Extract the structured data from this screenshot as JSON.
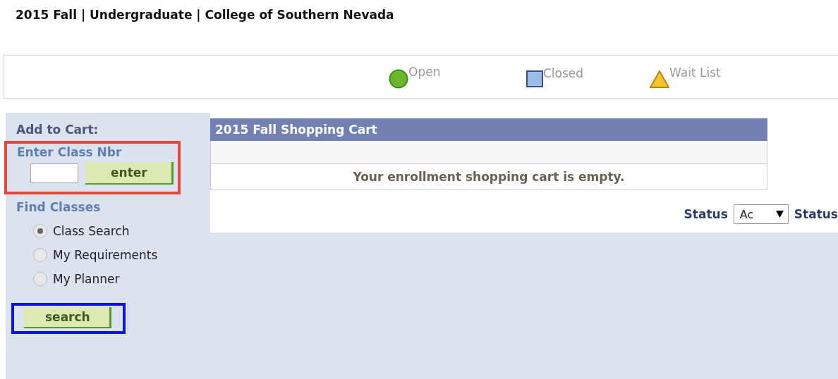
{
  "page_title": "2015 Fall | Undergraduate | College of Southern Nevada",
  "legend": [
    {
      "kind": "circle",
      "label": "Open"
    },
    {
      "kind": "square",
      "label": "Closed"
    },
    {
      "kind": "triangle",
      "label": "Wait List"
    }
  ],
  "add_to_cart": {
    "heading": "Add to Cart:",
    "label": "Enter Class Nbr",
    "button": "enter",
    "highlight": {
      "color": "#e8453c"
    }
  },
  "find_classes": {
    "heading": "Find Classes",
    "options": [
      {
        "label": "Class Search",
        "selected": true
      },
      {
        "label": "My Requirements",
        "selected": false
      },
      {
        "label": "My Planner",
        "selected": false
      }
    ],
    "button": "search",
    "highlight": {
      "color": "#0a14e6"
    }
  },
  "cart": {
    "title": "2015 Fall Shopping Cart",
    "message": "Your enrollment shopping cart is empty."
  },
  "filter": {
    "label": "Status",
    "select_value": "Ac",
    "trailing_label": "Status"
  }
}
